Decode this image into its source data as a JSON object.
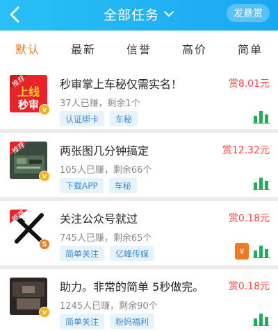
{
  "header": {
    "title": "全部任务",
    "post_button": "发悬赏",
    "bg_color": "#1fb2f2",
    "icons": {
      "back": "back-arrow-icon",
      "dropdown": "chevron-down-icon"
    }
  },
  "tabs": [
    {
      "label": "默认",
      "active": true
    },
    {
      "label": "最新",
      "active": false
    },
    {
      "label": "信誉",
      "active": false
    },
    {
      "label": "高价",
      "active": false
    },
    {
      "label": "简单",
      "active": false
    }
  ],
  "accent_color": "#f07a24",
  "reward_color": "#f0463c",
  "tasks": [
    {
      "title": "秒审掌上车秘仅需实名！",
      "meta": "37人已赚，剩余1个",
      "reward": "赏8.01元",
      "tags": [
        "认证绑卡",
        "车秘"
      ],
      "thumb_banner": "推荐",
      "thumb_text_top": "上线",
      "thumb_text_bottom": "秒审",
      "badge": "v",
      "has_red_packet": false
    },
    {
      "title": "两张图几分钟搞定",
      "meta": "105人已赚，剩余66个",
      "reward": "赏12.32元",
      "tags": [
        "下载APP",
        "车秘"
      ],
      "thumb_banner": "推荐",
      "badge": "v",
      "has_red_packet": false
    },
    {
      "title": "关注公众号就过",
      "meta": "745人已赚，剩余65个",
      "reward": "赏0.18元",
      "tags": [
        "简单关注",
        "亿峰传媒"
      ],
      "thumb_banner": "推荐",
      "badge": "S",
      "has_red_packet": true,
      "red_packet_symbol": "¥"
    },
    {
      "title": "助力。非常的简单 5秒做完。",
      "meta": "1245人已赚，剩余90个",
      "reward": "赏0.18元",
      "tags": [
        "简单关注",
        "粉妈福利"
      ],
      "badge": "v",
      "has_red_packet": false
    }
  ]
}
